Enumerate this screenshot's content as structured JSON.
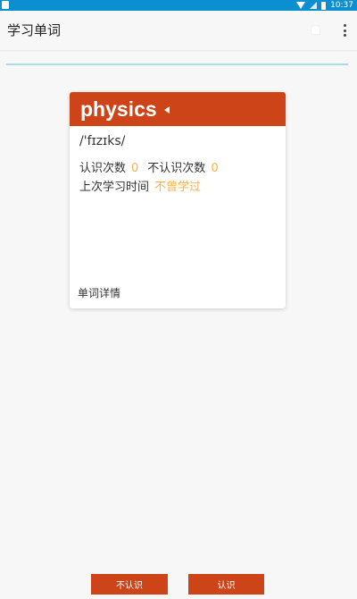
{
  "status_bar": {
    "time": "10:37"
  },
  "app_bar": {
    "title": "学习单词"
  },
  "card": {
    "word": "physics",
    "phonetic": "/'fɪzɪks/",
    "known_label": "认识次数",
    "known_count": "0",
    "unknown_label": "不认识次数",
    "unknown_count": "0",
    "last_study_label": "上次学习时间",
    "last_study_value": "不曾学过",
    "details_label": "单词详情"
  },
  "actions": {
    "unknown_label": "不认识",
    "known_label": "认识"
  },
  "colors": {
    "status_bar": "#0b8fd0",
    "accent": "#cc4418",
    "highlight": "#f3b34a",
    "progress": "#a9dde0"
  }
}
